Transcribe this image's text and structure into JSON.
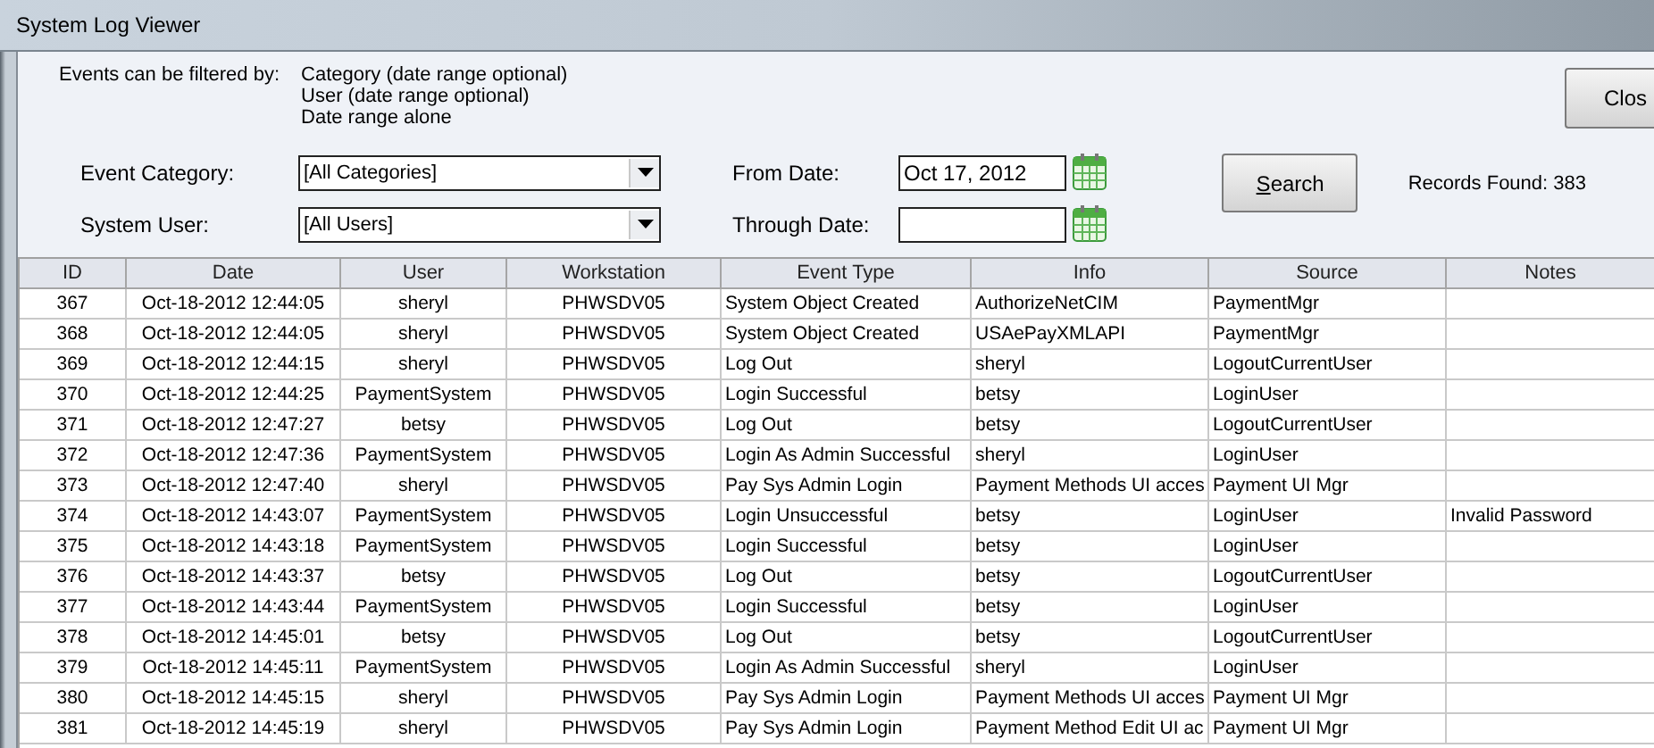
{
  "window": {
    "title": "System Log Viewer"
  },
  "filter_info": {
    "label": "Events can be filtered by:",
    "options": [
      "Category (date range optional)",
      "User (date range optional)",
      "Date range alone"
    ]
  },
  "event_category": {
    "label": "Event Category:",
    "value": "[All Categories]"
  },
  "system_user": {
    "label": "System User:",
    "value": "[All Users]"
  },
  "from_date": {
    "label": "From Date:",
    "value": "Oct 17, 2012"
  },
  "through_date": {
    "label": "Through Date:"
  },
  "search_button": "Search",
  "close_button": "Clos",
  "records_found": "Records Found: 383",
  "table": {
    "columns": [
      "ID",
      "Date",
      "User",
      "Workstation",
      "Event Type",
      "Info",
      "Source",
      "Notes"
    ],
    "rows": [
      {
        "id": "367",
        "date": "Oct-18-2012 12:44:05",
        "user": "sheryl",
        "workstation": "PHWSDV05",
        "event_type": "System Object Created",
        "info": "AuthorizeNetCIM",
        "source": "PaymentMgr"
      },
      {
        "id": "368",
        "date": "Oct-18-2012 12:44:05",
        "user": "sheryl",
        "workstation": "PHWSDV05",
        "event_type": "System Object Created",
        "info": "USAePayXMLAPI",
        "source": "PaymentMgr"
      },
      {
        "id": "369",
        "date": "Oct-18-2012 12:44:15",
        "user": "sheryl",
        "workstation": "PHWSDV05",
        "event_type": "Log Out",
        "info": "sheryl",
        "source": "LogoutCurrentUser"
      },
      {
        "id": "370",
        "date": "Oct-18-2012 12:44:25",
        "user": "PaymentSystem",
        "workstation": "PHWSDV05",
        "event_type": "Login Successful",
        "info": "betsy",
        "source": "LoginUser"
      },
      {
        "id": "371",
        "date": "Oct-18-2012 12:47:27",
        "user": "betsy",
        "workstation": "PHWSDV05",
        "event_type": "Log Out",
        "info": "betsy",
        "source": "LogoutCurrentUser"
      },
      {
        "id": "372",
        "date": "Oct-18-2012 12:47:36",
        "user": "PaymentSystem",
        "workstation": "PHWSDV05",
        "event_type": "Login As Admin Successful",
        "info": "sheryl",
        "source": "LoginUser"
      },
      {
        "id": "373",
        "date": "Oct-18-2012 12:47:40",
        "user": "sheryl",
        "workstation": "PHWSDV05",
        "event_type": "Pay Sys Admin Login",
        "info": "Payment Methods UI acces",
        "source": "Payment UI Mgr"
      },
      {
        "id": "374",
        "date": "Oct-18-2012 14:43:07",
        "user": "PaymentSystem",
        "workstation": "PHWSDV05",
        "event_type": "Login Unsuccessful",
        "info": "betsy",
        "source": "LoginUser",
        "notes": "Invalid Password"
      },
      {
        "id": "375",
        "date": "Oct-18-2012 14:43:18",
        "user": "PaymentSystem",
        "workstation": "PHWSDV05",
        "event_type": "Login Successful",
        "info": "betsy",
        "source": "LoginUser"
      },
      {
        "id": "376",
        "date": "Oct-18-2012 14:43:37",
        "user": "betsy",
        "workstation": "PHWSDV05",
        "event_type": "Log Out",
        "info": "betsy",
        "source": "LogoutCurrentUser"
      },
      {
        "id": "377",
        "date": "Oct-18-2012 14:43:44",
        "user": "PaymentSystem",
        "workstation": "PHWSDV05",
        "event_type": "Login Successful",
        "info": "betsy",
        "source": "LoginUser"
      },
      {
        "id": "378",
        "date": "Oct-18-2012 14:45:01",
        "user": "betsy",
        "workstation": "PHWSDV05",
        "event_type": "Log Out",
        "info": "betsy",
        "source": "LogoutCurrentUser"
      },
      {
        "id": "379",
        "date": "Oct-18-2012 14:45:11",
        "user": "PaymentSystem",
        "workstation": "PHWSDV05",
        "event_type": "Login As Admin Successful",
        "info": "sheryl",
        "source": "LoginUser"
      },
      {
        "id": "380",
        "date": "Oct-18-2012 14:45:15",
        "user": "sheryl",
        "workstation": "PHWSDV05",
        "event_type": "Pay Sys Admin Login",
        "info": "Payment Methods UI acces",
        "source": "Payment UI Mgr"
      },
      {
        "id": "381",
        "date": "Oct-18-2012 14:45:19",
        "user": "sheryl",
        "workstation": "PHWSDV05",
        "event_type": "Pay Sys Admin Login",
        "info": "Payment Method Edit UI ac",
        "source": "Payment UI Mgr"
      }
    ]
  }
}
